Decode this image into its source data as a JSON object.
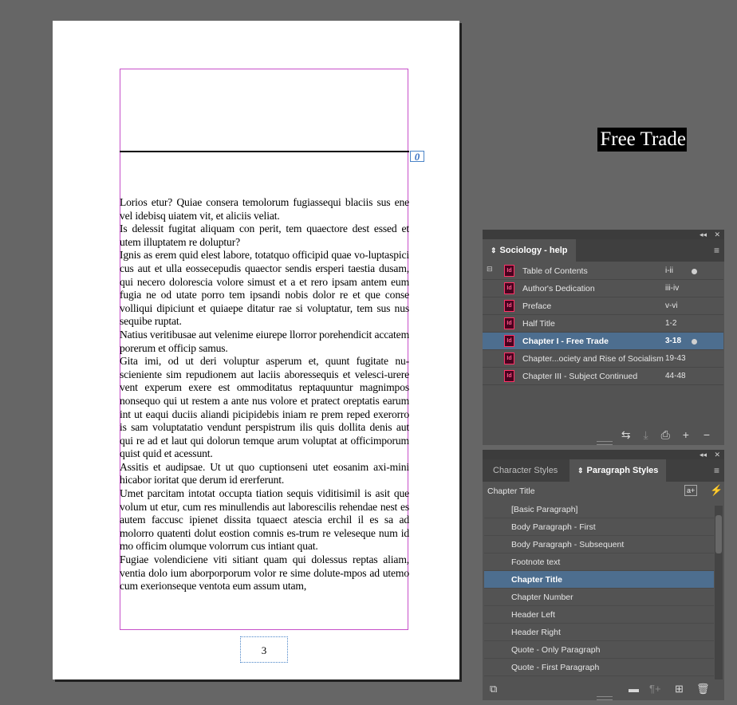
{
  "document": {
    "chapter_title": "Free Trade",
    "overset_marker": "0",
    "page_number": "3",
    "paragraphs": [
      "Lorios etur? Quiae consera temolorum fugiassequi blaciis sus ene vel idebisq uiatem vit, et aliciis veliat.",
      "Is delessit fugitat aliquam con perit, tem quaectore dest essed et utem illuptatem re doluptur?",
      "Ignis as erem quid elest labore, totatquo officipid quae vo-luptaspici cus aut et ulla eossecepudis quaector sendis ersperi taestia dusam, qui necero dolorescia volore simust et a et rero ipsam antem eum fugia ne od utate porro tem ipsandi nobis dolor re et que conse volliqui dipiciunt et quiaepe ditatur rae si voluptatur, tem sus nus sequibe ruptat.",
      "Natius veritibusae aut velenime eiurepe llorror porehendicit accatem porerum et officip samus.",
      "Gita imi, od ut deri voluptur asperum et, quunt fugitate nu-scieniente sim repudionem aut laciis aboressequis et velesci-urere vent experum exere est ommoditatus reptaquuntur magnimpos nonsequo qui ut restem a ante nus volore et pratect oreptatis earum int ut eaqui duciis aliandi picipidebis iniam re prem reped exerorro is sam voluptatatio vendunt perspistrum ilis quis dollita denis aut qui re ad et laut qui dolorun temque arum voluptat at officimporum quist quid et acessunt.",
      "Assitis et audipsae. Ut ut quo cuptionseni utet eosanim axi-mini hicabor ioritat que derum id ererferunt.",
      "Umet parcitam intotat occupta tiation sequis viditisimil is asit que volum ut etur, cum res minullendis aut laborescilis rehendae nest es autem faccusc ipienet dissita tquaect atescia erchil il es sa ad molorro quatenti dolut eostion comnis es-trum re veleseque num id mo officim olumque volorrum cus intiant quat.",
      "Fugiae volendiciene viti sitiant quam qui dolessus reptas aliam, ventia dolo ium aborporporum volor re sime dolute-mpos ad utemo cum exerionseque ventota eum assum utam,"
    ]
  },
  "book_panel": {
    "title": "Sociology - help",
    "collapse_icon": "double-chevron-left-icon",
    "close_icon": "close-icon",
    "menu_icon": "hamburger-icon",
    "items": [
      {
        "name": "Table of Contents",
        "pages": "i-ii",
        "dot": true,
        "selected": false,
        "style_source": true
      },
      {
        "name": "Author's Dedication",
        "pages": "iii-iv",
        "dot": false,
        "selected": false
      },
      {
        "name": "Preface",
        "pages": "v-vi",
        "dot": false,
        "selected": false
      },
      {
        "name": "Half Title",
        "pages": "1-2",
        "dot": false,
        "selected": false
      },
      {
        "name": "Chapter I - Free Trade",
        "pages": "3-18",
        "dot": true,
        "selected": true
      },
      {
        "name": "Chapter...ociety and Rise of Socialism",
        "pages": "19-43",
        "dot": false,
        "selected": false
      },
      {
        "name": "Chapter III - Subject Continued",
        "pages": "44-48",
        "dot": false,
        "selected": false
      }
    ],
    "toolbar": [
      "synchronize-icon",
      "save-book-icon",
      "print-book-icon",
      "add-document-icon",
      "remove-document-icon"
    ]
  },
  "styles_panel": {
    "tabs": [
      "Character Styles",
      "Paragraph Styles"
    ],
    "active_tab": "Paragraph Styles",
    "current_style": "Chapter Title",
    "items": [
      "[Basic Paragraph]",
      "Body Paragraph - First",
      "Body Paragraph - Subsequent",
      "Footnote text",
      "Chapter Title",
      "Chapter Number",
      "Header Left",
      "Header Right",
      "Quote - Only Paragraph",
      "Quote - First Paragraph"
    ],
    "selected_index": 4,
    "toolbar": [
      "style-override-icon",
      "new-folder-icon",
      "clear-overrides-icon",
      "new-style-icon",
      "delete-style-icon"
    ]
  },
  "colors": {
    "pasteboard": "#666666",
    "panel_bg": "#535353",
    "selection": "#4d6e8f",
    "margin_guide": "#c64fc9",
    "frame_edge": "#4a84c7"
  }
}
